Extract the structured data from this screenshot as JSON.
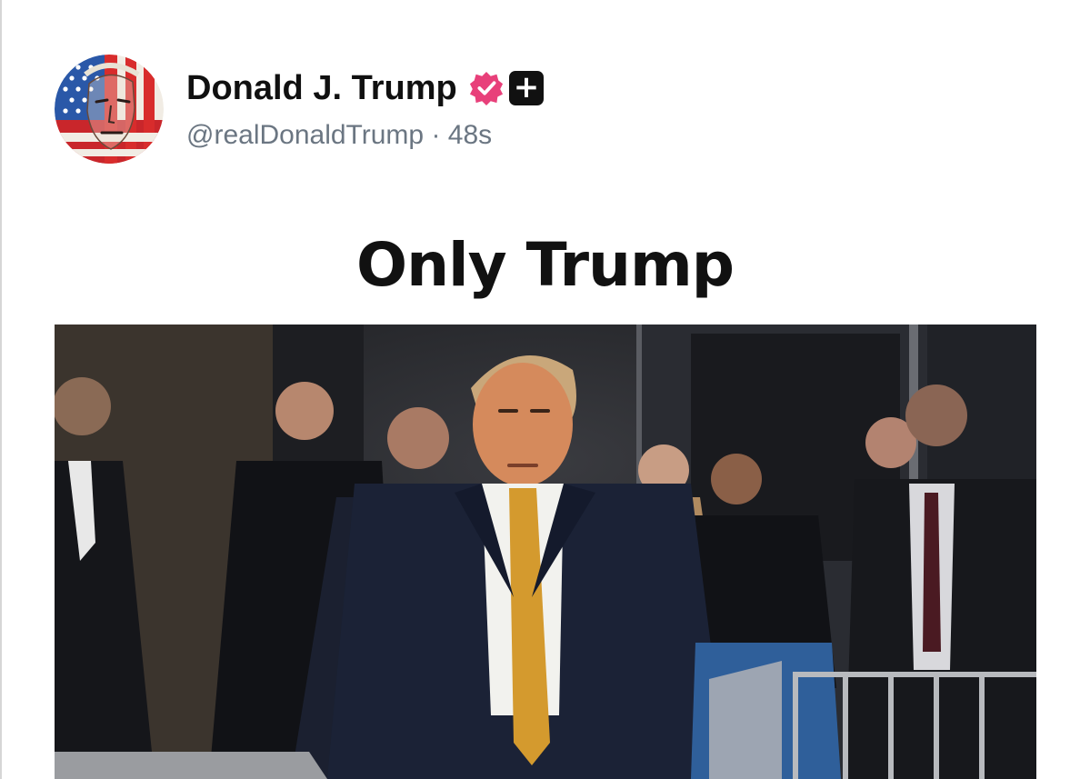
{
  "post": {
    "author": {
      "display_name": "Donald J. Trump",
      "handle": "@realDonaldTrump",
      "separator": " · ",
      "time_ago": "48s",
      "avatar_icon": "flag-face-avatar",
      "verified_icon": "verified-badge-icon",
      "verified_color": "#e8407a",
      "plus_badge_label": "+"
    },
    "media": {
      "title": "Only Trump",
      "photo_icon": "courthouse-photo"
    }
  }
}
